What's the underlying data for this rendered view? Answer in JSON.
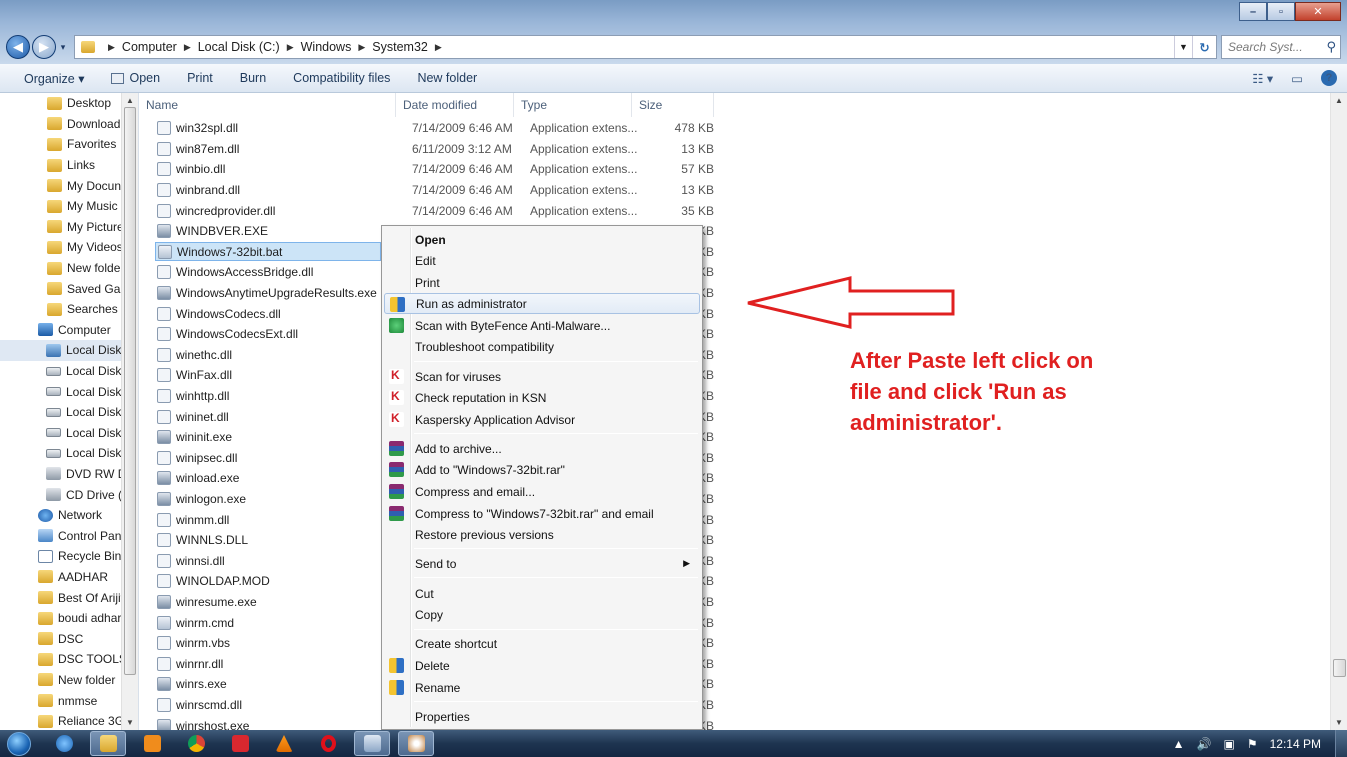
{
  "address": {
    "crumbs": [
      "Computer",
      "Local Disk (C:)",
      "Windows",
      "System32"
    ],
    "search_placeholder": "Search Syst..."
  },
  "window_controls": {
    "minimize": "–",
    "maximize": "▫",
    "close": "✕"
  },
  "toolbar": {
    "organize": "Organize ▾",
    "open": "Open",
    "print": "Print",
    "burn": "Burn",
    "compat": "Compatibility files",
    "new_folder": "New folder",
    "views": "☷ ▾",
    "help": "?"
  },
  "nav_pane": [
    {
      "label": "Desktop",
      "icon": "folder"
    },
    {
      "label": "Download",
      "icon": "folder"
    },
    {
      "label": "Favorites",
      "icon": "folder"
    },
    {
      "label": "Links",
      "icon": "folder"
    },
    {
      "label": "My Docun",
      "icon": "folder"
    },
    {
      "label": "My Music",
      "icon": "folder"
    },
    {
      "label": "My Picture",
      "icon": "folder"
    },
    {
      "label": "My Videos",
      "icon": "folder"
    },
    {
      "label": "New folde",
      "icon": "folder"
    },
    {
      "label": "Saved Gan",
      "icon": "folder"
    },
    {
      "label": "Searches",
      "icon": "folder"
    },
    {
      "label": "Computer",
      "icon": "pc"
    },
    {
      "label": "Local Disk",
      "icon": "sys",
      "selected": true
    },
    {
      "label": "Local Disk",
      "icon": "drive"
    },
    {
      "label": "Local Disk",
      "icon": "drive"
    },
    {
      "label": "Local Disk",
      "icon": "drive"
    },
    {
      "label": "Local Disk",
      "icon": "drive"
    },
    {
      "label": "Local Disk",
      "icon": "drive"
    },
    {
      "label": "DVD RW D",
      "icon": "dvd"
    },
    {
      "label": "CD Drive (",
      "icon": "dvd"
    },
    {
      "label": "Network",
      "icon": "net"
    },
    {
      "label": "Control Pan",
      "icon": "cp"
    },
    {
      "label": "Recycle Bin",
      "icon": "bin"
    },
    {
      "label": "AADHAR",
      "icon": "folder"
    },
    {
      "label": "Best Of Arijit",
      "icon": "folder"
    },
    {
      "label": "boudi adhar",
      "icon": "folder"
    },
    {
      "label": "DSC",
      "icon": "folder"
    },
    {
      "label": "DSC TOOLS",
      "icon": "folder"
    },
    {
      "label": "New folder",
      "icon": "folder"
    },
    {
      "label": "nmmse",
      "icon": "folder"
    },
    {
      "label": "Reliance 3G",
      "icon": "folder"
    }
  ],
  "columns": {
    "name": "Name",
    "date": "Date modified",
    "type": "Type",
    "size": "Size"
  },
  "files": [
    {
      "name": "win32spl.dll",
      "date": "7/14/2009 6:46 AM",
      "type": "Application extens...",
      "size": "478 KB",
      "kind": "dll"
    },
    {
      "name": "win87em.dll",
      "date": "6/11/2009 3:12 AM",
      "type": "Application extens...",
      "size": "13 KB",
      "kind": "dll"
    },
    {
      "name": "winbio.dll",
      "date": "7/14/2009 6:46 AM",
      "type": "Application extens...",
      "size": "57 KB",
      "kind": "dll"
    },
    {
      "name": "winbrand.dll",
      "date": "7/14/2009 6:46 AM",
      "type": "Application extens...",
      "size": "13 KB",
      "kind": "dll"
    },
    {
      "name": "wincredprovider.dll",
      "date": "7/14/2009 6:46 AM",
      "type": "Application extens...",
      "size": "35 KB",
      "kind": "dll"
    },
    {
      "name": "WINDBVER.EXE",
      "date": "",
      "type": "",
      "size": "KB",
      "kind": "exe"
    },
    {
      "name": "Windows7-32bit.bat",
      "date": "",
      "type": "",
      "size": "KB",
      "kind": "bat",
      "selected": true
    },
    {
      "name": "WindowsAccessBridge.dll",
      "date": "",
      "type": "",
      "size": "KB",
      "kind": "dll"
    },
    {
      "name": "WindowsAnytimeUpgradeResults.exe",
      "date": "",
      "type": "",
      "size": "KB",
      "kind": "exe"
    },
    {
      "name": "WindowsCodecs.dll",
      "date": "",
      "type": "",
      "size": "KB",
      "kind": "dll"
    },
    {
      "name": "WindowsCodecsExt.dll",
      "date": "",
      "type": "",
      "size": "KB",
      "kind": "dll"
    },
    {
      "name": "winethc.dll",
      "date": "",
      "type": "",
      "size": "KB",
      "kind": "dll"
    },
    {
      "name": "WinFax.dll",
      "date": "",
      "type": "",
      "size": "KB",
      "kind": "dll"
    },
    {
      "name": "winhttp.dll",
      "date": "",
      "type": "",
      "size": "KB",
      "kind": "dll"
    },
    {
      "name": "wininet.dll",
      "date": "",
      "type": "",
      "size": "KB",
      "kind": "dll"
    },
    {
      "name": "wininit.exe",
      "date": "",
      "type": "",
      "size": "KB",
      "kind": "exe"
    },
    {
      "name": "winipsec.dll",
      "date": "",
      "type": "",
      "size": "KB",
      "kind": "dll"
    },
    {
      "name": "winload.exe",
      "date": "",
      "type": "",
      "size": "KB",
      "kind": "exe"
    },
    {
      "name": "winlogon.exe",
      "date": "",
      "type": "",
      "size": "KB",
      "kind": "exe"
    },
    {
      "name": "winmm.dll",
      "date": "",
      "type": "",
      "size": "KB",
      "kind": "dll"
    },
    {
      "name": "WINNLS.DLL",
      "date": "",
      "type": "",
      "size": "KB",
      "kind": "dll"
    },
    {
      "name": "winnsi.dll",
      "date": "",
      "type": "",
      "size": "KB",
      "kind": "dll"
    },
    {
      "name": "WINOLDAP.MOD",
      "date": "",
      "type": "",
      "size": "KB",
      "kind": "dll"
    },
    {
      "name": "winresume.exe",
      "date": "",
      "type": "",
      "size": "KB",
      "kind": "exe"
    },
    {
      "name": "winrm.cmd",
      "date": "",
      "type": "",
      "size": "KB",
      "kind": "bat"
    },
    {
      "name": "winrm.vbs",
      "date": "",
      "type": "",
      "size": "KB",
      "kind": "dll"
    },
    {
      "name": "winrnr.dll",
      "date": "",
      "type": "",
      "size": "KB",
      "kind": "dll"
    },
    {
      "name": "winrs.exe",
      "date": "",
      "type": "",
      "size": "KB",
      "kind": "exe"
    },
    {
      "name": "winrscmd.dll",
      "date": "",
      "type": "",
      "size": "KB",
      "kind": "dll"
    },
    {
      "name": "winrshost.exe",
      "date": "",
      "type": "",
      "size": "KB",
      "kind": "exe"
    }
  ],
  "context_menu": {
    "open": "Open",
    "edit": "Edit",
    "print": "Print",
    "run_admin": "Run as administrator",
    "bytefence": "Scan with ByteFence Anti-Malware...",
    "troubleshoot": "Troubleshoot compatibility",
    "scan_viruses": "Scan for viruses",
    "check_ksn": "Check reputation in KSN",
    "kaspersky_advisor": "Kaspersky Application Advisor",
    "add_archive": "Add to archive...",
    "add_rar": "Add to \"Windows7-32bit.rar\"",
    "compress_email": "Compress and email...",
    "compress_rar_email": "Compress to \"Windows7-32bit.rar\" and email",
    "restore": "Restore previous versions",
    "send_to": "Send to",
    "cut": "Cut",
    "copy": "Copy",
    "create_shortcut": "Create shortcut",
    "delete": "Delete",
    "rename": "Rename",
    "properties": "Properties"
  },
  "annotation": {
    "line1": "After Paste left click on",
    "line2": "file and click 'Run as",
    "line3": "administrator'."
  },
  "annotation_color": "#e02020",
  "taskbar": {
    "time": "12:14 PM",
    "tray_up": "▲",
    "volume": "🔊",
    "network": "▣",
    "flag": "⚑"
  }
}
